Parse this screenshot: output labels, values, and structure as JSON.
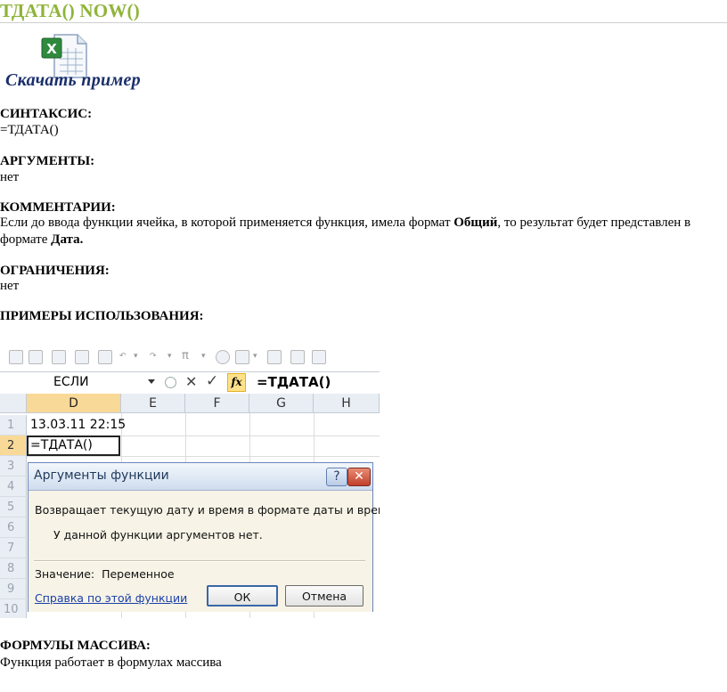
{
  "page": {
    "title": "ТДАТА() NOW()",
    "download_label": "Скачать пример",
    "sections": {
      "syntax": {
        "heading": "СИНТАКСИС:",
        "text": "=ТДАТА()"
      },
      "arguments": {
        "heading": "АРГУМЕНТЫ:",
        "text": "нет"
      },
      "comments": {
        "heading": "КОММЕНТАРИИ:",
        "text_1": "Если до ввода функции ячейка, в которой применяется функция, имела формат ",
        "bold_1": "Общий",
        "text_2": ", то результат будет представлен в формате ",
        "bold_2": "Дата."
      },
      "limitations": {
        "heading": "ОГРАНИЧЕНИЯ:",
        "text": "нет"
      },
      "examples": {
        "heading": "ПРИМЕРЫ ИСПОЛЬЗОВАНИЯ:"
      },
      "array_formulas": {
        "heading": "ФОРМУЛЫ МАССИВА:",
        "text": "Функция работает в формулах массива"
      }
    }
  },
  "excel": {
    "name_box": "ЕСЛИ",
    "formula": "=ТДАТА()",
    "fx_label": "fx",
    "columns": [
      "D",
      "E",
      "F",
      "G",
      "H"
    ],
    "rows": [
      "1",
      "2",
      "3",
      "4",
      "5",
      "6",
      "7",
      "8",
      "9",
      "10"
    ],
    "cells": {
      "D1": "13.03.11 22:15",
      "D2": "=ТДАТА()"
    },
    "dialog": {
      "title": "Аргументы функции",
      "help_label": "?",
      "close_label": "✕",
      "description": "Возвращает текущую дату и время в формате даты и времени.",
      "no_args": "У данной функции аргументов нет.",
      "value_label": "Значение:",
      "value": "Переменное",
      "help_link": "Справка по этой функции",
      "ok_label": "ОК",
      "cancel_label": "Отмена"
    }
  }
}
